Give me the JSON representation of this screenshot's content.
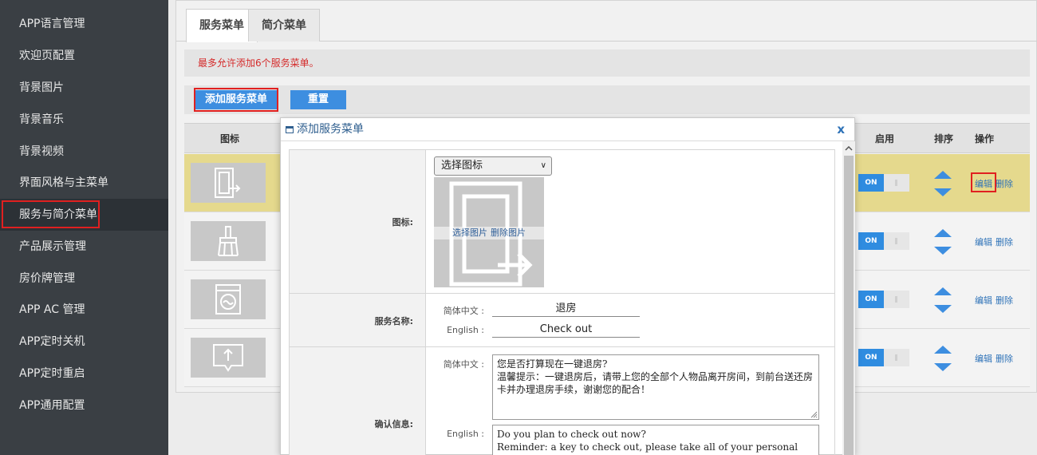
{
  "sidebar": {
    "items": [
      {
        "label": "APP语言管理"
      },
      {
        "label": "欢迎页配置"
      },
      {
        "label": "背景图片"
      },
      {
        "label": "背景音乐"
      },
      {
        "label": "背景视频"
      },
      {
        "label": "界面风格与主菜单"
      },
      {
        "label": "服务与简介菜单"
      },
      {
        "label": "产品展示管理"
      },
      {
        "label": "房价牌管理"
      },
      {
        "label": "APP AC 管理"
      },
      {
        "label": "APP定时关机"
      },
      {
        "label": "APP定时重启"
      },
      {
        "label": "APP通用配置"
      }
    ],
    "active_index": 6
  },
  "tabs": [
    {
      "label": "服务菜单"
    },
    {
      "label": "简介菜单"
    }
  ],
  "notice": "最多允许添加6个服务菜单。",
  "toolbar": {
    "add_label": "添加服务菜单",
    "reset_label": "重置"
  },
  "table": {
    "headers": {
      "icon": "图标",
      "enabled": "启用",
      "sort": "排序",
      "actions": "操作"
    },
    "rows": [
      {
        "icon": "door-exit-icon",
        "enabled": "ON",
        "edit": "编辑",
        "delete": "删除",
        "selected": true
      },
      {
        "icon": "broom-icon",
        "enabled": "ON",
        "edit": "编辑",
        "delete": "删除",
        "selected": false
      },
      {
        "icon": "washing-machine-icon",
        "enabled": "ON",
        "edit": "编辑",
        "delete": "删除",
        "selected": false
      },
      {
        "icon": "message-upload-icon",
        "enabled": "ON",
        "edit": "编辑",
        "delete": "删除",
        "selected": false
      }
    ]
  },
  "dialog": {
    "title": "添加服务菜单",
    "close_label": "x",
    "icon_field": {
      "label": "图标:",
      "select_value": "选择图标",
      "choose_image": "选择图片",
      "delete_image": "删除图片"
    },
    "name_field": {
      "label": "服务名称:",
      "zh_label": "简体中文 :",
      "zh_value": "退房",
      "en_label": "English :",
      "en_value": "Check out"
    },
    "confirm_field": {
      "label": "确认信息:",
      "zh_label": "简体中文 :",
      "zh_value": "您是否打算现在一键退房?\n温馨提示：一键退房后，请带上您的全部个人物品离开房间，到前台送还房卡并办理退房手续，谢谢您的配合！",
      "en_label": "English :",
      "en_value": "Do you plan to check out now?\nReminder: a key to check out, please take all of your personal"
    }
  },
  "colors": {
    "sidebar_bg": "#3a3f44",
    "accent_blue": "#3d8ee0",
    "highlight_red": "#e02020",
    "selected_row": "#e5d98d",
    "notice_red": "#d52b2b"
  }
}
